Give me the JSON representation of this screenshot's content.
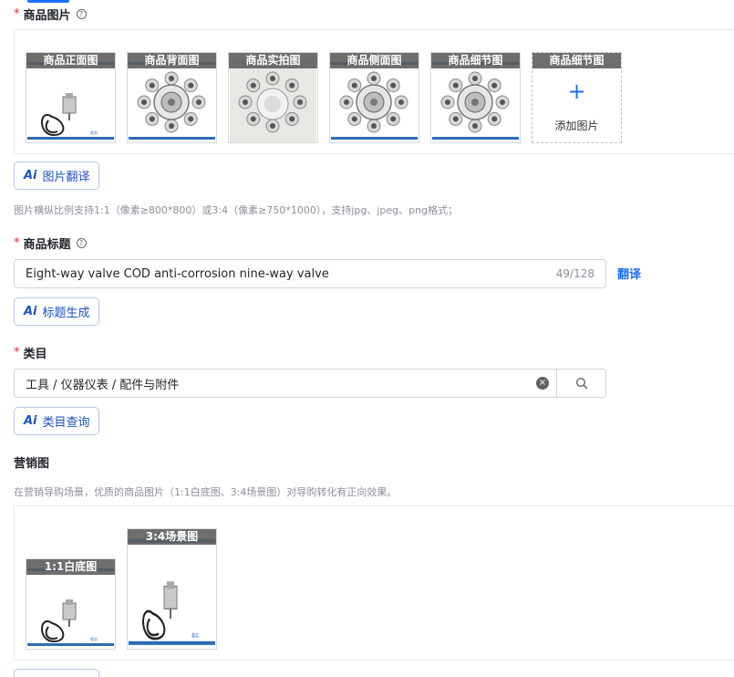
{
  "product_images": {
    "title": "商品图片",
    "help": "?",
    "slots": [
      {
        "label": "商品正面图",
        "art": "coil"
      },
      {
        "label": "商品背面图",
        "art": "valve"
      },
      {
        "label": "商品实拍图",
        "art": "valve-real"
      },
      {
        "label": "商品侧面图",
        "art": "valve"
      },
      {
        "label": "商品细节图",
        "art": "valve"
      }
    ],
    "add_slot": {
      "label": "商品细节图",
      "plus": "+",
      "add_text": "添加图片"
    },
    "ai_translate": {
      "ai": "Ai",
      "label": "图片翻译"
    },
    "hint": "图片横纵比例支持1:1（像素≥800*800）或3:4（像素≥750*1000），支持jpg、jpeg、png格式；"
  },
  "product_title": {
    "title": "商品标题",
    "help": "?",
    "value": "Eight-way valve COD anti-corrosion nine-way valve",
    "count": "49/128",
    "translate": "翻译",
    "ai_generate": {
      "ai": "Ai",
      "label": "标题生成"
    }
  },
  "category": {
    "title": "类目",
    "value": "工具 / 仪器仪表 / 配件与附件",
    "clear": "×",
    "ai_query": {
      "ai": "Ai",
      "label": "类目查询"
    }
  },
  "marketing": {
    "title": "营销图",
    "hint": "在营销导购场景，优质的商品图片（1:1白底图、3:4场景图）对导购转化有正向效果。",
    "slots": [
      {
        "label": "1:1白底图",
        "art": "coil"
      },
      {
        "label": "3:4场景图",
        "art": "coil-tall"
      }
    ]
  },
  "colors": {
    "accent": "#1e6fff",
    "ai_text": "#1e50c8",
    "required": "#f5222d",
    "thumb_label_bg": "#5a5a5a"
  }
}
